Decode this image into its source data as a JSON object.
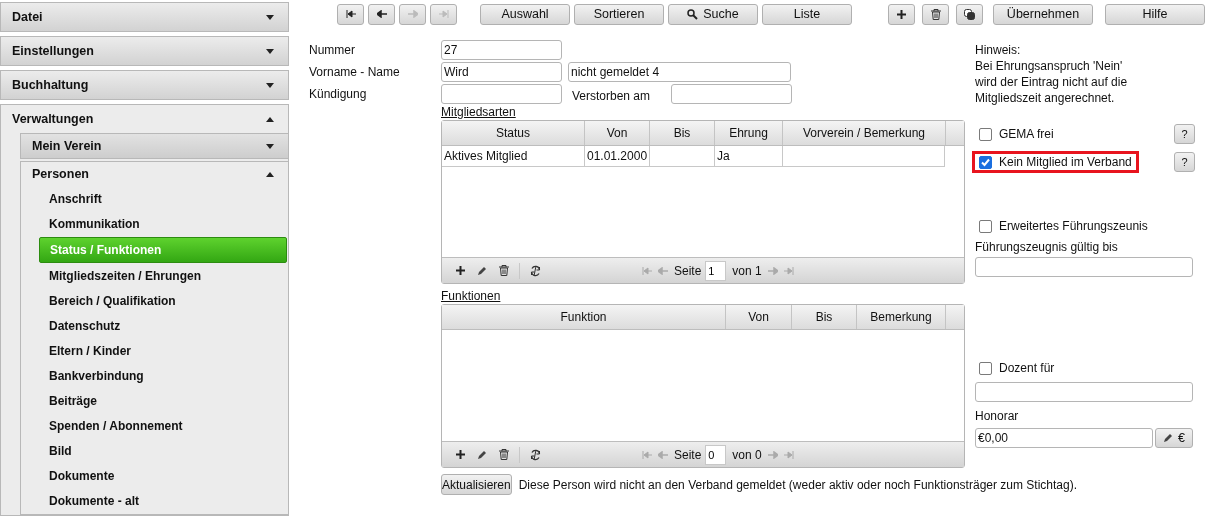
{
  "sidebar": {
    "sections": [
      {
        "label": "Datei",
        "expanded": false
      },
      {
        "label": "Einstellungen",
        "expanded": false
      },
      {
        "label": "Buchhaltung",
        "expanded": false
      },
      {
        "label": "Verwaltungen",
        "expanded": true,
        "children": [
          {
            "label": "Mein Verein",
            "expanded": false
          },
          {
            "label": "Personen",
            "expanded": true,
            "children": [
              {
                "label": "Anschrift",
                "selected": false
              },
              {
                "label": "Kommunikation",
                "selected": false
              },
              {
                "label": "Status / Funktionen",
                "selected": true
              },
              {
                "label": "Mitgliedszeiten / Ehrungen",
                "selected": false
              },
              {
                "label": "Bereich / Qualifikation",
                "selected": false
              },
              {
                "label": "Datenschutz",
                "selected": false
              },
              {
                "label": "Eltern / Kinder",
                "selected": false
              },
              {
                "label": "Bankverbindung",
                "selected": false
              },
              {
                "label": "Beiträge",
                "selected": false
              },
              {
                "label": "Spenden / Abonnement",
                "selected": false
              },
              {
                "label": "Bild",
                "selected": false
              },
              {
                "label": "Dokumente",
                "selected": false
              },
              {
                "label": "Dokumente - alt",
                "selected": false
              }
            ]
          }
        ]
      }
    ]
  },
  "toolbar": {
    "nav_buttons": [
      {
        "kind": "first",
        "disabled": false
      },
      {
        "kind": "prev",
        "disabled": false
      },
      {
        "kind": "next",
        "disabled": true
      },
      {
        "kind": "last",
        "disabled": true
      }
    ],
    "buttons": [
      {
        "label": "Auswahl"
      },
      {
        "label": "Sortieren"
      },
      {
        "label": "Suche",
        "kind": "search"
      },
      {
        "label": "Liste"
      }
    ],
    "icon_buttons": [
      {
        "kind": "add"
      },
      {
        "kind": "delete"
      },
      {
        "kind": "copy"
      }
    ],
    "text_buttons": [
      "Übernehmen",
      "Hilfe"
    ]
  },
  "form": {
    "nummer": {
      "label": "Nummer",
      "value": "27"
    },
    "name": {
      "label": "Vorname - Name",
      "first": "Wird",
      "last": "nicht gemeldet 4"
    },
    "kuendigung": {
      "label": "Kündigung",
      "verstorben_label": "Verstorben am"
    }
  },
  "tables": [
    {
      "title": "Mitgliedsarten",
      "columns": [
        "Status",
        "Von",
        "Bis",
        "Ehrung",
        "Vorverein / Bemerkung"
      ],
      "rows": [
        [
          "Aktives Mitglied",
          "01.01.2000",
          null,
          "Ja",
          null
        ]
      ],
      "pager": {
        "label": "Seite",
        "page": "1",
        "total": "von 1"
      }
    },
    {
      "title": "Funktionen",
      "columns": [
        "Funktion",
        "Von",
        "Bis",
        "Bemerkung"
      ],
      "pager": {
        "label": "Seite",
        "page": "0",
        "total": "von 0"
      }
    }
  ],
  "hint": {
    "title": "Hinweis:",
    "text": "Bei Ehrungsanspruch 'Nein' wird der Eintrag nicht auf die Mitgliedszeit angerechnet."
  },
  "options": [
    {
      "label": "GEMA frei",
      "checked": false,
      "help": "?",
      "highlighted": false
    },
    {
      "label": "Kein Mitglied im Verband",
      "checked": true,
      "help": "?",
      "highlighted": true
    }
  ],
  "fuehrungszeugnis": {
    "label": "Erweitertes Führungszeunis",
    "checked": false,
    "date_label": "Führungszeugnis gültig bis"
  },
  "dozent": {
    "label": "Dozent für",
    "checked": false
  },
  "honorar": {
    "label": "Honorar",
    "value": "€0,00",
    "button": "€"
  },
  "footer": {
    "button": "Aktualisieren",
    "message": "Diese Person wird nicht an den Verband gemeldet (weder aktiv oder noch Funktionsträger zum Stichtag)."
  }
}
